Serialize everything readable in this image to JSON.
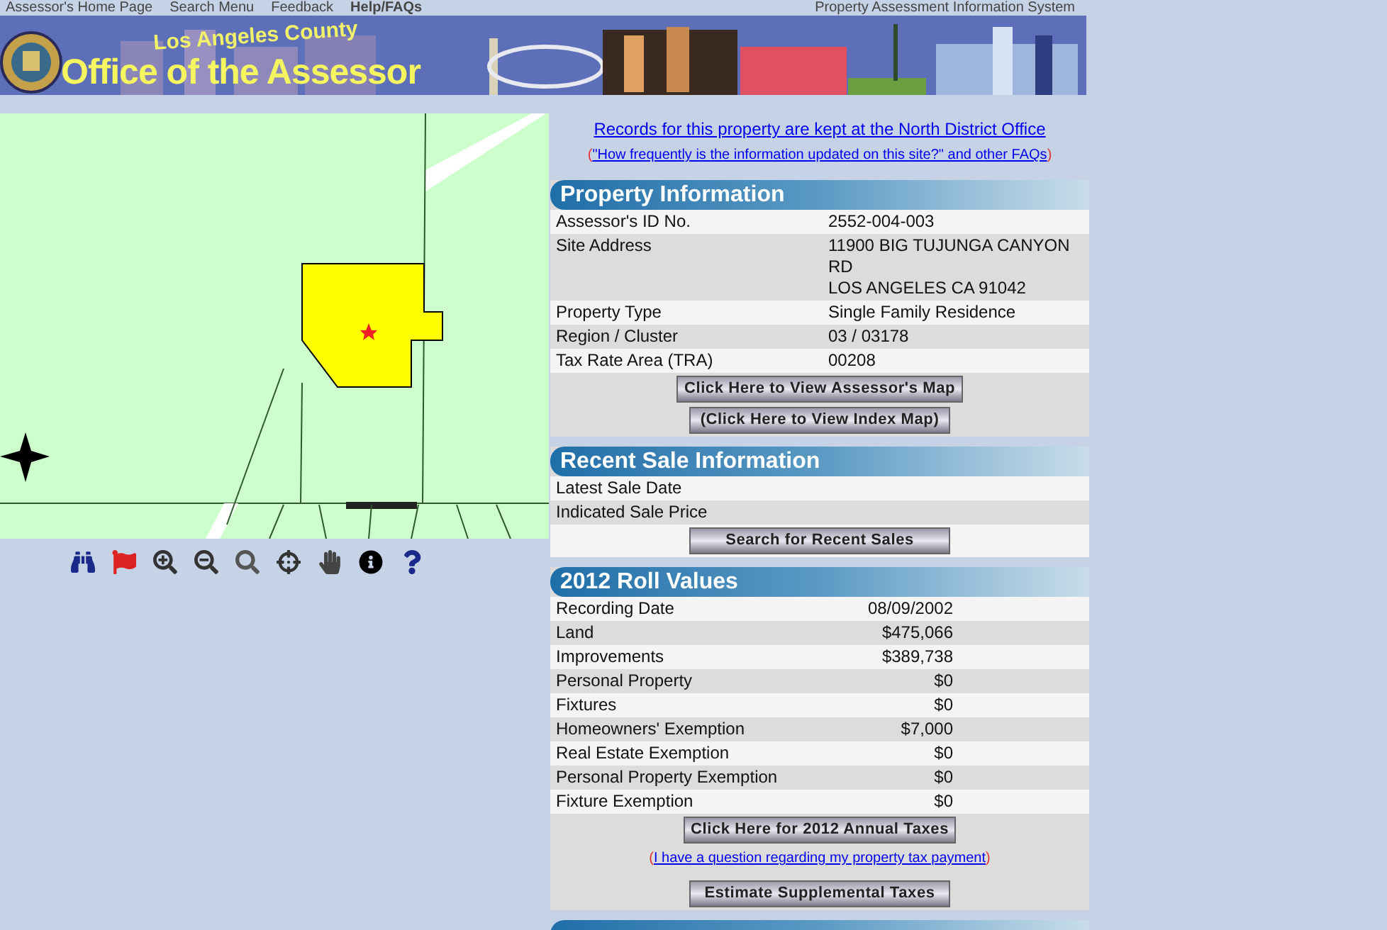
{
  "top_nav": {
    "links": [
      {
        "label": "Assessor's Home Page",
        "selected": false
      },
      {
        "label": "Search Menu",
        "selected": false
      },
      {
        "label": "Feedback",
        "selected": false
      },
      {
        "label": "Help/FAQs",
        "selected": true
      }
    ],
    "system_name": "Property Assessment Information System"
  },
  "banner": {
    "subtitle": "Los Angeles County",
    "title": "Office of the Assessor"
  },
  "map_tools": [
    {
      "kind": "binoculars"
    },
    {
      "kind": "flag"
    },
    {
      "kind": "zoom-in"
    },
    {
      "kind": "zoom-out"
    },
    {
      "kind": "magnifier"
    },
    {
      "kind": "zoom-point"
    },
    {
      "kind": "hand"
    },
    {
      "kind": "info"
    },
    {
      "kind": "help"
    }
  ],
  "district_link": "Records for this property are kept at the North District Office",
  "faq_link": {
    "open": "(",
    "label": "\"How frequently is the information updated on this site?\" and other FAQs ",
    "close": ")"
  },
  "sections": [
    {
      "title": "Property Information",
      "rows": [
        {
          "label": "Assessor's ID No.",
          "value": [
            "2552-004-003"
          ]
        },
        {
          "label": "Site Address",
          "value": [
            "11900 BIG TUJUNGA CANYON",
            "RD",
            "LOS ANGELES CA 91042"
          ]
        },
        {
          "label": "Property Type",
          "value": [
            "Single Family Residence"
          ]
        },
        {
          "label": "Region / Cluster",
          "value": [
            "03 / 03178"
          ]
        },
        {
          "label": "Tax Rate Area (TRA)",
          "value": [
            "00208"
          ]
        }
      ],
      "actions": [
        {
          "kind": "button",
          "label": "Click Here to View Assessor's Map"
        },
        {
          "kind": "button",
          "label": "(Click Here to View Index Map)"
        }
      ]
    },
    {
      "title": "Recent Sale Information",
      "rows": [
        {
          "label": "Latest Sale Date"
        },
        {
          "label": "Indicated Sale Price"
        }
      ],
      "actions": [
        {
          "kind": "button",
          "label": "Search for Recent Sales"
        }
      ]
    },
    {
      "title": "2012 Roll Values",
      "rows": [
        {
          "label": "Recording Date",
          "value": [
            "08/09/2002"
          ]
        },
        {
          "label": "Land",
          "value": [
            "$475,066"
          ]
        },
        {
          "label": "Improvements",
          "value": [
            "$389,738"
          ]
        },
        {
          "label": "Personal Property",
          "value": [
            "$0"
          ]
        },
        {
          "label": "Fixtures",
          "value": [
            "$0"
          ]
        },
        {
          "label": "Homeowners' Exemption",
          "value": [
            "$7,000"
          ]
        },
        {
          "label": "Real Estate Exemption",
          "value": [
            "$0"
          ]
        },
        {
          "label": "Personal Property Exemption",
          "value": [
            "$0"
          ]
        },
        {
          "label": "Fixture Exemption",
          "value": [
            "$0"
          ]
        }
      ],
      "actions": [
        {
          "kind": "button",
          "label": "Click Here for 2012 Annual Taxes"
        },
        {
          "kind": "link",
          "open": "(",
          "label": "I have a question regarding my property tax payment",
          "close": ")"
        },
        {
          "kind": "button",
          "label": "Estimate Supplemental Taxes"
        }
      ]
    }
  ]
}
